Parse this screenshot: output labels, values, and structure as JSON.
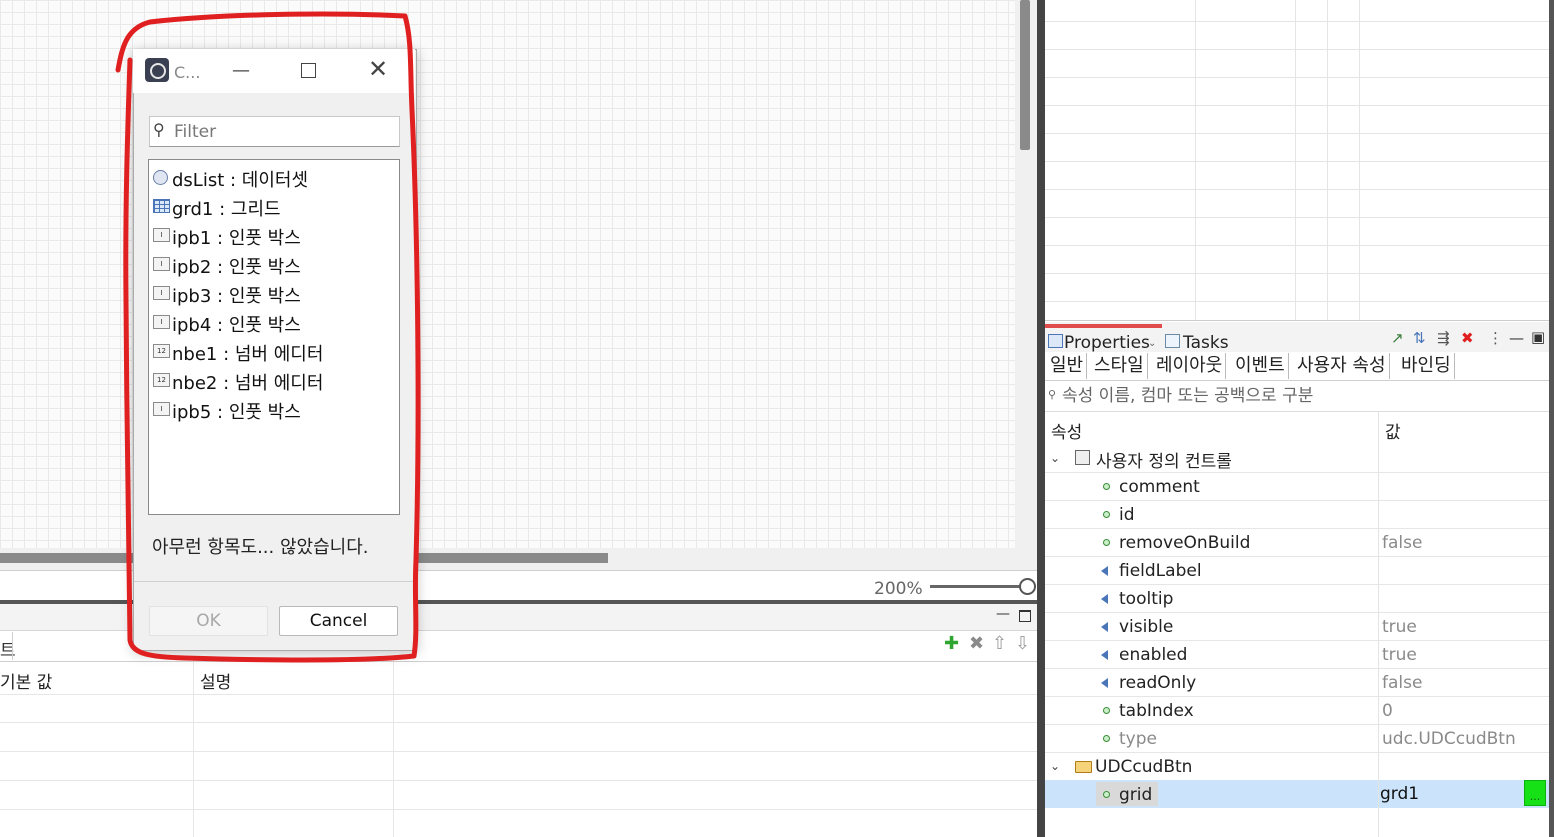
{
  "canvas": {
    "zoom_label": "200%"
  },
  "bottom_panel": {
    "tab_label": "트",
    "columns": [
      "기본 값",
      "설명"
    ],
    "tool_icons": [
      "add-icon",
      "delete-icon",
      "move-up-icon",
      "move-down-icon"
    ]
  },
  "properties_panel": {
    "tab_label": "Properties",
    "second_tab_label": "Tasks",
    "subtabs": [
      "일반",
      "스타일",
      "레이아웃",
      "이벤트",
      "사용자 속성",
      "바인딩"
    ],
    "search_placeholder": "속성 이름, 컴마 또는 공백으로 구분",
    "col_property": "속성",
    "col_value": "값",
    "group1": "사용자 정의 컨트롤",
    "rows": [
      {
        "name": "comment",
        "value": "",
        "icon": "dot"
      },
      {
        "name": "id",
        "value": "",
        "icon": "dot"
      },
      {
        "name": "removeOnBuild",
        "value": "false",
        "icon": "dot"
      },
      {
        "name": "fieldLabel",
        "value": "",
        "icon": "tri"
      },
      {
        "name": "tooltip",
        "value": "",
        "icon": "tri"
      },
      {
        "name": "visible",
        "value": "true",
        "icon": "tri"
      },
      {
        "name": "enabled",
        "value": "true",
        "icon": "tri"
      },
      {
        "name": "readOnly",
        "value": "false",
        "icon": "tri"
      },
      {
        "name": "tabIndex",
        "value": "0",
        "icon": "dot"
      },
      {
        "name": "type",
        "value": "udc.UDCcudBtn",
        "icon": "dot"
      }
    ],
    "group2": "UDCcudBtn",
    "selected_row": {
      "name": "grid",
      "value": "grd1"
    },
    "ellipsis": "..."
  },
  "dialog": {
    "title": "C...",
    "filter_placeholder": "Filter",
    "items": [
      {
        "label": "dsList : 데이터셋",
        "icon": "dataset-icon"
      },
      {
        "label": "grd1 : 그리드",
        "icon": "grid-icon"
      },
      {
        "label": "ipb1 : 인풋 박스",
        "icon": "input-box-icon"
      },
      {
        "label": "ipb2 : 인풋 박스",
        "icon": "input-box-icon"
      },
      {
        "label": "ipb3 : 인풋 박스",
        "icon": "input-box-icon"
      },
      {
        "label": "ipb4 : 인풋 박스",
        "icon": "input-box-icon"
      },
      {
        "label": "nbe1 : 넘버 에디터",
        "icon": "number-editor-icon"
      },
      {
        "label": "nbe2 : 넘버 에디터",
        "icon": "number-editor-icon"
      },
      {
        "label": "ipb5 : 인풋 박스",
        "icon": "input-box-icon"
      }
    ],
    "status": "아무런 항목도... 않았습니다.",
    "ok_label": "OK",
    "cancel_label": "Cancel"
  },
  "colors": {
    "annotation": "#e02020",
    "selection": "#cce4fb",
    "ellipsis_button": "#16e016"
  }
}
